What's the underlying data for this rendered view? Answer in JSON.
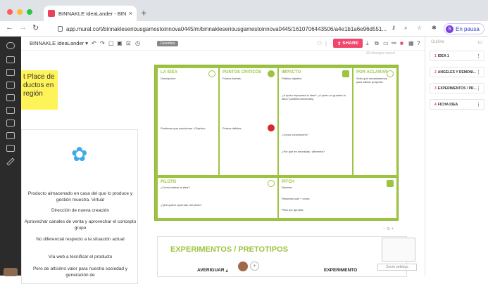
{
  "browser": {
    "tab_title": "BINNAKLE IdeaLander - BINN",
    "tab_close": "×",
    "new_tab": "+",
    "url": "app.mural.co/t/binnakleseriousgamestoinnova0445/m/binnakleseriousgamestoinnova0445/1610706443506/a4e1b1a6e96d551...",
    "profile_initial": "S",
    "profile_status": "En pausa",
    "traffic_colors": [
      "#ff5f57",
      "#febc2e",
      "#28c840"
    ]
  },
  "mural": {
    "title": "BINNAKLE IdeaLander",
    "fav_chip": "Favorites",
    "share_label": "SHARE",
    "saved_text": "All changes saved"
  },
  "sticky": {
    "text": "t Place de ductos en región"
  },
  "card": {
    "lines": [
      "Producto almacenado en casa del que lo produce y gestión muestra. Virtual",
      "Dirección de nueva creación",
      "Aprovechar canales de venta y aprovechar el concepto grupo",
      "No diferencial respecto a la situación actual",
      "Vía web a tecnificar el producto",
      "Pero de altísimo valor para nuestra sociedad y generación de"
    ]
  },
  "board": {
    "idea": {
      "title": "LA IDEA",
      "desc": "Descripción:",
      "problem": "Problema que solucionas / Objetivo:"
    },
    "puntos": {
      "title": "PUNTOS CRITICOS",
      "strong": "Puntos fuertes:",
      "weak": "Puntos débiles:"
    },
    "impacto": {
      "title": "IMPACTO",
      "public": "Público objetivo:",
      "q1": "¿A quién impactará la idea? ¿A quién no gustará la idea? (Antiintervenientes)",
      "q2": "¿Cómo convencerle?",
      "q3": "¿Por qué es necesitas / diferente?"
    },
    "aclarar": {
      "title": "POR ACLARAR",
      "desc": "Sello que necesitaremos para validar proyecto:"
    },
    "piloto": {
      "title": "PILOTO",
      "q1": "¿Cómo testear la idea?",
      "q2": "¿Qué quiero aprender del piloto?"
    },
    "pitch": {
      "title": "PITCH",
      "l1": "Nombre:",
      "l2": "Resumen qué + cómo:",
      "l3": "Pitch por aprobar:"
    }
  },
  "experiments": {
    "title": "EXPERIMENTOS / PRETOTIPOS",
    "col1": "AVERIGUAR ¿",
    "col2": "EXPERIMENTO"
  },
  "zoom": {
    "settings": "Zoom settings"
  },
  "outline": {
    "title": "Outline",
    "items": [
      {
        "n": "1",
        "label": "IDEA 1"
      },
      {
        "n": "2",
        "label": "ANGELES Y DEMONI..."
      },
      {
        "n": "3",
        "label": "EXPERIMENTOS / PR..."
      },
      {
        "n": "4",
        "label": "FICHA IDEA"
      }
    ]
  }
}
